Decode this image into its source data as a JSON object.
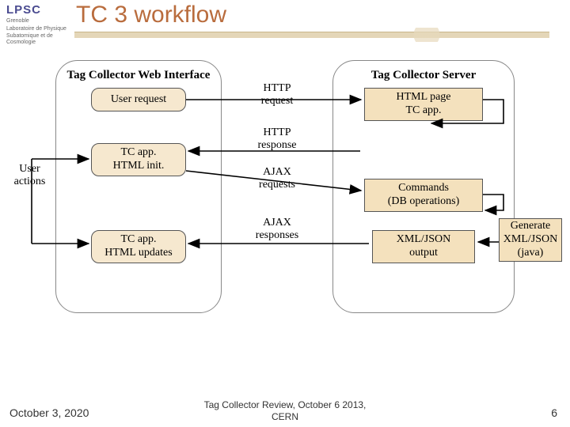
{
  "header": {
    "logo_top": "LPSC",
    "logo_city": "Grenoble",
    "logo_sub1": "Laboratoire de Physique",
    "logo_sub2": "Subatomique et de Cosmologie",
    "title": "TC 3 workflow"
  },
  "left_panel": {
    "title": "Tag Collector Web Interface"
  },
  "right_panel": {
    "title": "Tag Collector Server"
  },
  "boxes": {
    "user_request": "User request",
    "tc_init_l1": "TC app.",
    "tc_init_l2": "HTML init.",
    "tc_upd_l1": "TC app.",
    "tc_upd_l2": "HTML updates",
    "html_page_l1": "HTML page",
    "html_page_l2": "TC app.",
    "commands_l1": "Commands",
    "commands_l2": "(DB operations)",
    "xml_out_l1": "XML/JSON",
    "xml_out_l2": "output",
    "gen_l1": "Generate",
    "gen_l2": "XML/JSON",
    "gen_l3": "(java)"
  },
  "mid": {
    "http_req_l1": "HTTP",
    "http_req_l2": "request",
    "http_res_l1": "HTTP",
    "http_res_l2": "response",
    "ajax_req_l1": "AJAX",
    "ajax_req_l2": "requests",
    "ajax_res_l1": "AJAX",
    "ajax_res_l2": "responses"
  },
  "side": {
    "user_actions_l1": "User",
    "user_actions_l2": "actions"
  },
  "footer": {
    "date": "October 3, 2020",
    "center_l1": "Tag Collector Review, October 6 2013,",
    "center_l2": "CERN",
    "page": "6"
  }
}
